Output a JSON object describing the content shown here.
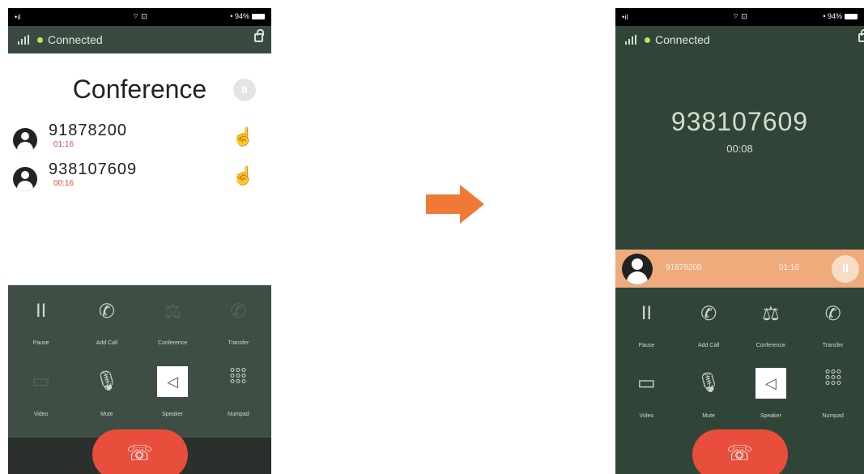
{
  "status_bar": {
    "left": {
      "signal": "•ıl",
      "wifi": "⌔ ⊡",
      "battery": "• 94%"
    },
    "right": {
      "signal": "•ıl",
      "wifi": "⌔ ⊡",
      "battery": "• 94%"
    }
  },
  "connection": {
    "status": "Connected"
  },
  "conference_screen": {
    "title": "Conference",
    "pause_symbol": "II",
    "participants": [
      {
        "number": "91878200",
        "time": "01:16"
      },
      {
        "number": "938107609",
        "time": "00:16"
      }
    ],
    "buttons": [
      {
        "label": "Pause"
      },
      {
        "label": "Add Call"
      },
      {
        "label": "Conference"
      },
      {
        "label": "Transfer"
      },
      {
        "label": "Video"
      },
      {
        "label": "Mute"
      },
      {
        "label": "Speaker"
      },
      {
        "label": "Numpad"
      }
    ]
  },
  "call_screen": {
    "number": "938107609",
    "time": "00:08",
    "held_call": {
      "number": "91878200",
      "time": "01:16",
      "pause_symbol": "II"
    },
    "buttons": [
      {
        "label": "Pause"
      },
      {
        "label": "Add Call"
      },
      {
        "label": "Conference"
      },
      {
        "label": "Transfer"
      },
      {
        "label": "Video"
      },
      {
        "label": "Mute"
      },
      {
        "label": "Speaker"
      },
      {
        "label": "Numpad"
      }
    ]
  },
  "colors": {
    "accent_arrow": "#f07a35",
    "end_call": "#e94d3c",
    "panel": "#3f4e44",
    "held_bar": "#efab7c",
    "connected_dot": "#b7e36a"
  }
}
